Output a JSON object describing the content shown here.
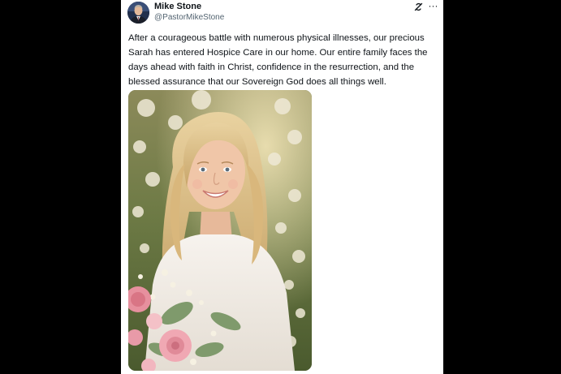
{
  "post": {
    "author": {
      "display_name": "Mike Stone",
      "handle": "@PastorMikeStone",
      "avatar_icon": "profile-photo"
    },
    "header_icons": [
      "grok-icon",
      "more-options-icon"
    ],
    "more_label": "···",
    "text": "After a courageous battle with numerous physical illnesses, our precious Sarah has entered Hospice Care in our home. Our entire family faces the days ahead with faith in Christ, confidence in the resurrection, and the blessed assurance that our Sovereign God does all things well.",
    "media": {
      "type": "photo",
      "description_icon": "portrait-photo"
    }
  },
  "colors": {
    "page_background": "#000000",
    "card_background": "#ffffff",
    "text_primary": "#0f1419",
    "text_secondary": "#536471"
  }
}
